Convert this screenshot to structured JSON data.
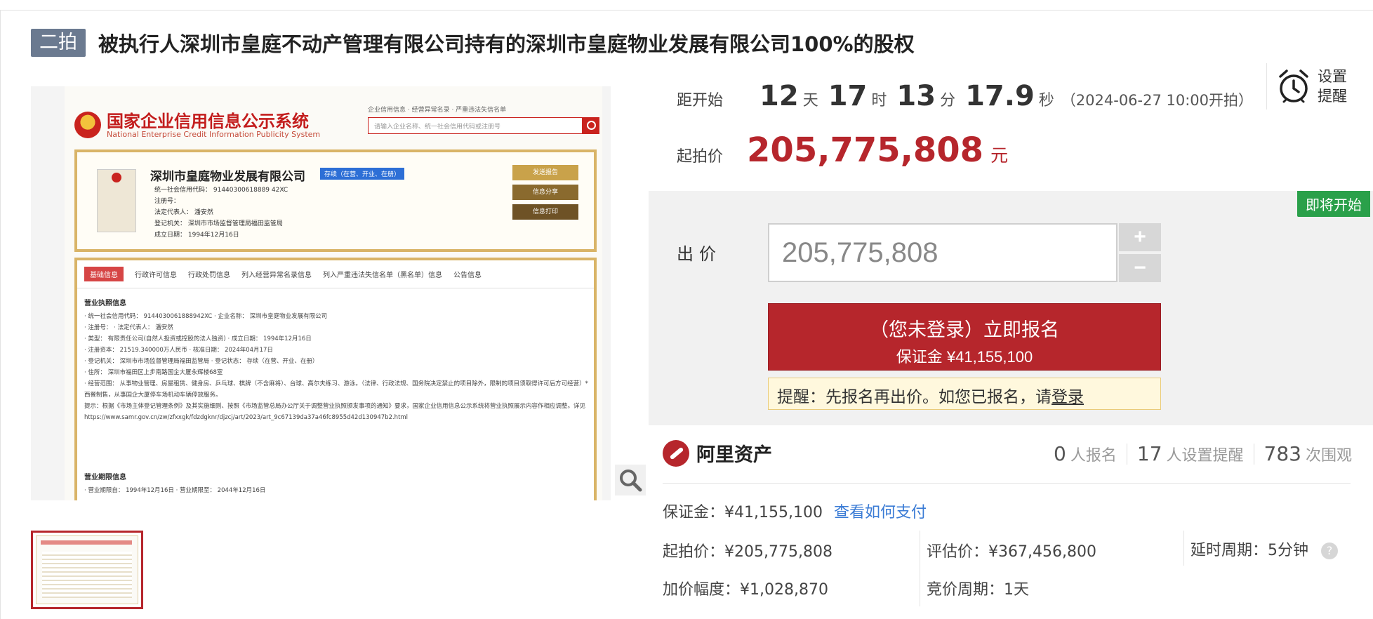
{
  "title": {
    "round_tag": "二拍",
    "text": "被执行人深圳市皇庭不动产管理有限公司持有的深圳市皇庭物业发展有限公司100%的股权"
  },
  "image_doc": {
    "site_title": "国家企业信用信息公示系统",
    "site_subtitle": "National Enterprise Credit Information Publicity System",
    "search_links": "企业信用信息 · 经营异常名录 · 严重违法失信名单",
    "search_placeholder": "请输入企业名称、统一社会信用代码或注册号",
    "company_name": "深圳市皇庭物业发展有限公司",
    "company_status": "存续（在营、开业、在册）",
    "company_lines": [
      "统一社会信用代码：  91440300618889 42XC",
      "注册号：",
      "法定代表人：  潘安然",
      "登记机关：  深圳市市场监督管理局福田监管局",
      "成立日期：  1994年12月16日"
    ],
    "gold_buttons": [
      "发送报告",
      "信息分享",
      "信息打印"
    ],
    "tabs": [
      "基础信息",
      "行政许可信息",
      "行政处罚信息",
      "列入经营异常名录信息",
      "列入严重违法失信名单（黑名单）信息",
      "公告信息"
    ],
    "section1": "营业执照信息",
    "section1_lines": [
      "· 统一社会信用代码：  9144030061888942XC                              · 企业名称：  深圳市皇庭物业发展有限公司",
      "· 注册号：                                                           · 法定代表人：  潘安然",
      "· 类型：  有限责任公司(自然人投资或控股的法人独资)                        · 成立日期：  1994年12月16日",
      "· 注册资本：  21519.340000万人民币                                     · 核准日期：  2024年04月17日",
      "· 登记机关：  深圳市市场监督管理局福田监管局                               · 登记状态：  存续（在营、开业、在册）",
      "· 住所：  深圳市福田区上步南路国企大厦永辉楼68室",
      "· 经营范围：  从事物业管理、房屋租赁、健身房、乒乓球、棋牌（不含麻将）、台球、高尔夫练习、游泳。（法律、行政法规、国务院决定禁止的项目除外，限制的项目须取得许可后方可经营）*西餐制售，从事国企大厦停车场机动车辆停放服务。",
      "提示：根据《市场主体登记管理条例》及其实施细则、按照《市场监管总局办公厅关于调整营业执照颁发事项的通知》要求，国家企业信用信息公示系统将营业执照展示内容作相应调整。详见https://www.samr.gov.cn/zw/zfxxgk/fdzdgknr/djzcj/art/2023/art_9c67139da37a46fc8955d42d130947b2.html"
    ],
    "section2": "营业期限信息",
    "section2_line": "· 营业期限自：  1994年12月16日                                         · 营业期限至：  2044年12月16日"
  },
  "countdown": {
    "label": "距开始",
    "days": "12",
    "days_unit": "天",
    "hours": "17",
    "hours_unit": "时",
    "minutes": "13",
    "minutes_unit": "分",
    "seconds": "17.9",
    "seconds_unit": "秒",
    "start_text": "（2024-06-27 10:00开拍）"
  },
  "reminder": {
    "line1": "设置",
    "line2": "提醒"
  },
  "start_price": {
    "label": "起拍价",
    "value": "205,775,808",
    "unit": "元"
  },
  "bid": {
    "status_chip": "即将开始",
    "label": "出价",
    "input_value": "205,775,808",
    "plus": "+",
    "minus": "−",
    "signup_main": "（您未登录）立即报名",
    "signup_sub": "保证金 ¥41,155,100",
    "tip_text": "提醒：先报名再出价。如您已报名，请",
    "tip_link": "登录"
  },
  "brand": {
    "name": "阿里资产"
  },
  "stats": {
    "signups": "0",
    "signups_label": "人报名",
    "reminders": "17",
    "reminders_label": "人设置提醒",
    "views": "783",
    "views_label": "次围观"
  },
  "info": {
    "deposit": "保证金：¥41,155,100",
    "how_to_pay": "查看如何支付",
    "start_price": "起拍价：¥205,775,808",
    "appraisal": "评估价：¥367,456,800",
    "delay": "延时周期：5分钟",
    "increment": "加价幅度：¥1,028,870",
    "bid_period": "竞价周期：1天",
    "help_glyph": "?"
  }
}
